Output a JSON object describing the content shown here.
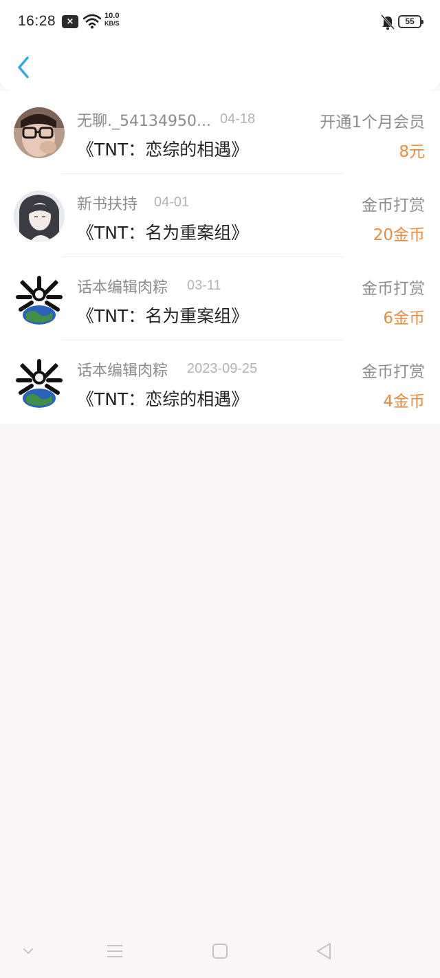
{
  "status_bar": {
    "time": "16:28",
    "notification_icon": "x-mark-icon",
    "wifi_icon": "wifi-icon",
    "speed_value": "10.0",
    "speed_unit": "KB/S",
    "bell_icon": "bell-off-icon",
    "battery": "55"
  },
  "header": {
    "back_icon": "chevron-left-icon",
    "accent_color": "#2ea8e6"
  },
  "items": [
    {
      "user": "无聊._54134950...",
      "date": "04-18",
      "type": "开通1个月会员",
      "book": "《TNT：恋综的相遇》",
      "amount": "8元",
      "avatar": "user-photo-avatar"
    },
    {
      "user": "新书扶持",
      "date": "04-01",
      "type": "金币打赏",
      "book": "《TNT：名为重案组》",
      "amount": "20金币",
      "avatar": "anime-character-avatar"
    },
    {
      "user": "话本编辑肉粽",
      "date": "03-11",
      "type": "金币打赏",
      "book": "《TNT：名为重案组》",
      "amount": "6金币",
      "avatar": "skull-globe-avatar"
    },
    {
      "user": "话本编辑肉粽",
      "date": "2023-09-25",
      "type": "金币打赏",
      "book": "《TNT：恋综的相遇》",
      "amount": "4金币",
      "avatar": "skull-globe-avatar"
    }
  ],
  "colors": {
    "amount": "#ee8a3c",
    "secondary_text": "#8c8c8c",
    "background": "#f8f6f7"
  },
  "nav": {
    "collapse_icon": "chevron-down-icon",
    "menu_icon": "menu-icon",
    "home_icon": "square-home-icon",
    "back_icon": "triangle-back-icon"
  }
}
